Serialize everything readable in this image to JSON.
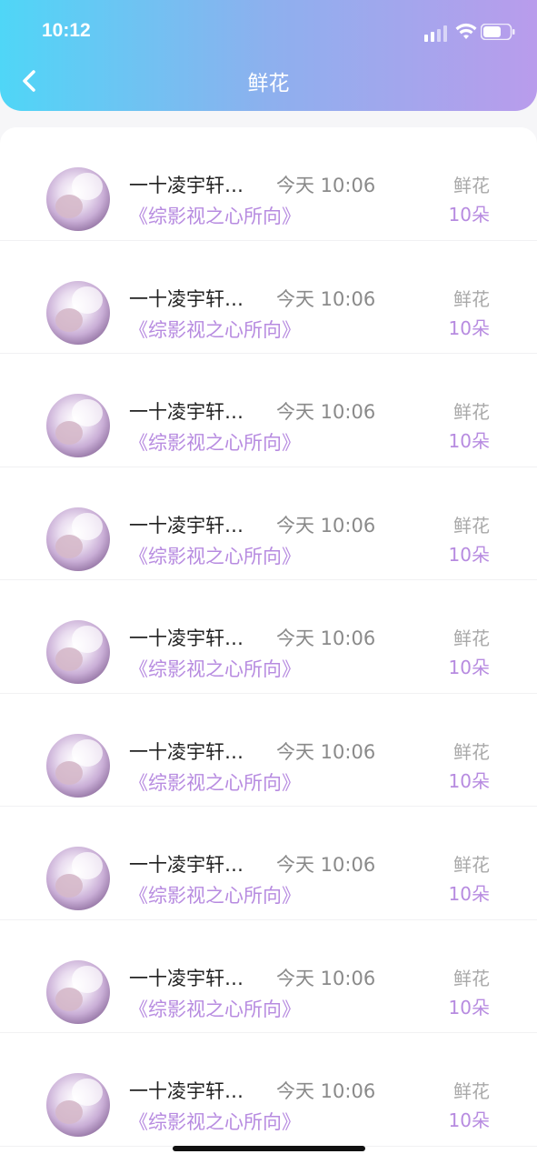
{
  "status_bar": {
    "time": "10:12"
  },
  "header": {
    "title": "鲜花"
  },
  "records": [
    {
      "name": "一十凌宇轩…",
      "time": "今天 10:06",
      "book": "《综影视之心所向》",
      "gift_type": "鲜花",
      "gift_count": "10朵"
    },
    {
      "name": "一十凌宇轩…",
      "time": "今天 10:06",
      "book": "《综影视之心所向》",
      "gift_type": "鲜花",
      "gift_count": "10朵"
    },
    {
      "name": "一十凌宇轩…",
      "time": "今天 10:06",
      "book": "《综影视之心所向》",
      "gift_type": "鲜花",
      "gift_count": "10朵"
    },
    {
      "name": "一十凌宇轩…",
      "time": "今天 10:06",
      "book": "《综影视之心所向》",
      "gift_type": "鲜花",
      "gift_count": "10朵"
    },
    {
      "name": "一十凌宇轩…",
      "time": "今天 10:06",
      "book": "《综影视之心所向》",
      "gift_type": "鲜花",
      "gift_count": "10朵"
    },
    {
      "name": "一十凌宇轩…",
      "time": "今天 10:06",
      "book": "《综影视之心所向》",
      "gift_type": "鲜花",
      "gift_count": "10朵"
    },
    {
      "name": "一十凌宇轩…",
      "time": "今天 10:06",
      "book": "《综影视之心所向》",
      "gift_type": "鲜花",
      "gift_count": "10朵"
    },
    {
      "name": "一十凌宇轩…",
      "time": "今天 10:06",
      "book": "《综影视之心所向》",
      "gift_type": "鲜花",
      "gift_count": "10朵"
    },
    {
      "name": "一十凌宇轩…",
      "time": "今天 10:06",
      "book": "《综影视之心所向》",
      "gift_type": "鲜花",
      "gift_count": "10朵"
    }
  ],
  "colors": {
    "header_gradient_start": "#4fd6f7",
    "header_gradient_end": "#b99cec",
    "accent_purple": "#b78be0",
    "muted_gray": "#8a8a8a"
  },
  "icons": {
    "back": "chevron-left-icon",
    "signal": "signal-icon",
    "wifi": "wifi-icon",
    "battery": "battery-icon"
  }
}
